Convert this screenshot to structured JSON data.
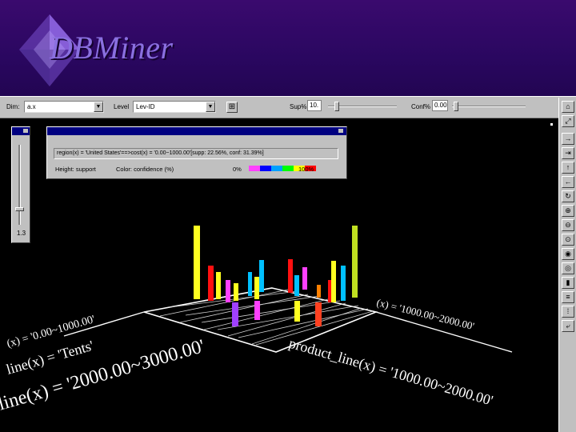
{
  "header": {
    "logo_text": "DBMiner",
    "background": "#2a0760",
    "logo_color": "#8a70e0"
  },
  "toolbar": {
    "dim_label": "Dim:",
    "dim_value": "a.x",
    "level_label": "Level",
    "level_value": "Lev-ID",
    "support_label": "Sup%",
    "support_value": "10.",
    "conf_label": "Conf%",
    "conf_value": "0.00"
  },
  "left_panel": {
    "value": "1.3"
  },
  "info_panel": {
    "rule": "region(x) = 'United States'==>cost(x) = '0.00~1000.00'[supp: 22.56%, conf: 31.39%]",
    "height_label": "Height: support",
    "color_label": "Color: confidence (%)",
    "scale_min": "0%",
    "scale_max": "100%",
    "scale_colors": [
      "#ff40ff",
      "#0000ff",
      "#00a0ff",
      "#00ff00",
      "#ffff00",
      "#ff0000"
    ]
  },
  "right_tools": [
    "home-icon",
    "zoom-icon",
    "arrow-right-icon",
    "arrow-up-icon",
    "arrow-down-icon",
    "arrow-left-icon",
    "rotate-icon",
    "zoom-in-icon",
    "zoom-out-icon",
    "reset-icon",
    "eye-icon",
    "eye-alt-icon",
    "bars-icon",
    "legend-icon",
    "scatter-icon",
    "exit-icon"
  ],
  "axis_text": {
    "left_front": "line(x) = '2000.00~3000.00'",
    "left_mid": "line(x) = 'Tents'",
    "left_back": "(x) = '0.00~1000.00'",
    "right_front": "product_line(x) = '1000.00~2000.00'",
    "right_back": "(x) = '1000.00~2000.00'"
  }
}
